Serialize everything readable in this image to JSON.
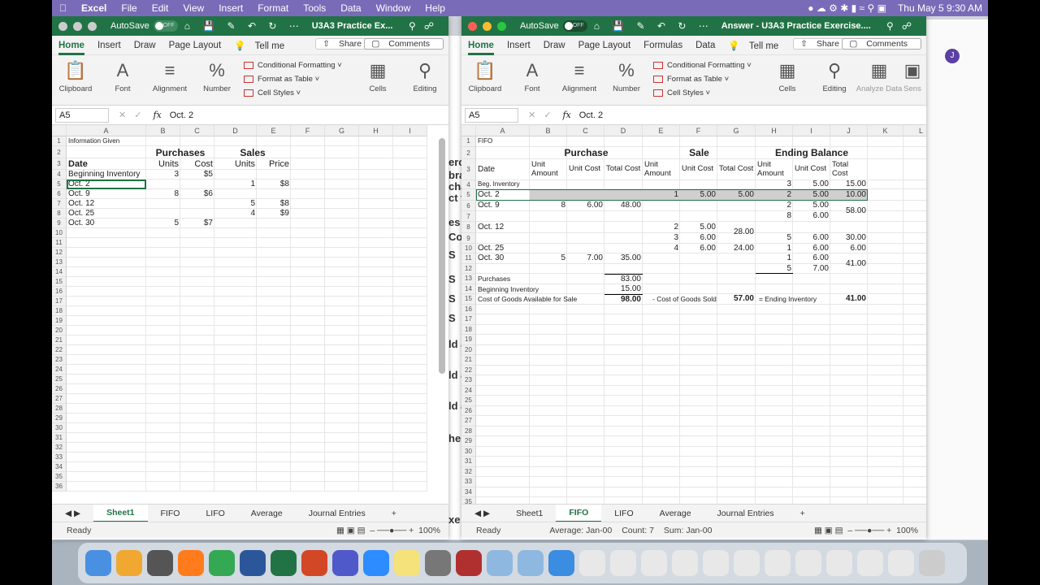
{
  "menubar": {
    "app": "Excel",
    "items": [
      "File",
      "Edit",
      "View",
      "Insert",
      "Format",
      "Tools",
      "Data",
      "Window",
      "Help"
    ],
    "clock": "Thu May 5  9:30 AM"
  },
  "left_window": {
    "autosave_label": "AutoSave",
    "autosave_state": "OFF",
    "title": "U3A3 Practice Ex...",
    "tabs": [
      "Home",
      "Insert",
      "Draw",
      "Page Layout"
    ],
    "tell_me": "Tell me",
    "share": "Share",
    "comments": "Comments",
    "ribbon": {
      "clipboard": "Clipboard",
      "font": "Font",
      "alignment": "Alignment",
      "number": "Number",
      "cond_format": "Conditional Formatting",
      "format_table": "Format as Table",
      "cell_styles": "Cell Styles",
      "cells": "Cells",
      "editing": "Editing"
    },
    "namebox": "A5",
    "formula": "Oct. 2",
    "columns": [
      "A",
      "B",
      "C",
      "D",
      "E",
      "F",
      "G",
      "H",
      "I"
    ],
    "cells": {
      "r1a": "Information Given",
      "r2purch": "Purchases",
      "r2sales": "Sales",
      "r3a": "Date",
      "r3b": "Units",
      "r3c": "Cost",
      "r3d": "Units",
      "r3e": "Price",
      "r4a": "Beginning Inventory",
      "r4b": "3",
      "r4c": "$5",
      "r5a": "Oct. 2",
      "r5d": "1",
      "r5e": "$8",
      "r6a": "Oct. 9",
      "r6b": "8",
      "r6c": "$6",
      "r7a": "Oct. 12",
      "r7d": "5",
      "r7e": "$8",
      "r8a": "Oct. 25",
      "r8d": "4",
      "r8e": "$9",
      "r9a": "Oct. 30",
      "r9b": "5",
      "r9c": "$7"
    },
    "sheet_tabs": [
      "Sheet1",
      "FIFO",
      "LIFO",
      "Average",
      "Journal Entries"
    ],
    "active_tab": "Sheet1",
    "status": "Ready",
    "zoom": "100%"
  },
  "right_window": {
    "autosave_label": "AutoSave",
    "autosave_state": "OFF",
    "title": "Answer - U3A3 Practice Exercise....",
    "tabs": [
      "Home",
      "Insert",
      "Draw",
      "Page Layout",
      "Formulas",
      "Data"
    ],
    "tell_me": "Tell me",
    "share": "Share",
    "comments": "Comments",
    "ribbon": {
      "clipboard": "Clipboard",
      "font": "Font",
      "alignment": "Alignment",
      "number": "Number",
      "cond_format": "Conditional Formatting",
      "format_table": "Format as Table",
      "cell_styles": "Cell Styles",
      "cells": "Cells",
      "editing": "Editing",
      "analyze": "Analyze Data",
      "sens": "Sens"
    },
    "namebox": "A5",
    "formula": "Oct. 2",
    "columns": [
      "A",
      "B",
      "C",
      "D",
      "E",
      "F",
      "G",
      "H",
      "I",
      "J",
      "K",
      "L"
    ],
    "cells": {
      "r1a": "FIFO",
      "r2purch": "Purchase",
      "r2sale": "Sale",
      "r2end": "Ending Balance",
      "r3a": "Date",
      "r3b": "Unit Amount",
      "r3c": "Unit Cost",
      "r3d": "Total Cost",
      "r3e": "Unit Amount",
      "r3f": "Unit Cost",
      "r3g": "Total Cost",
      "r3h": "Unit Amount",
      "r3i": "Unit Cost",
      "r3j": "Total Cost",
      "r4a": "Beg. Inventory",
      "r4h": "3",
      "r4i": "5.00",
      "r4j": "15.00",
      "r5a": "Oct. 2",
      "r5e": "1",
      "r5f": "5.00",
      "r5g": "5.00",
      "r5h": "2",
      "r5i": "5.00",
      "r5j": "10.00",
      "r6a": "Oct. 9",
      "r6b": "8",
      "r6c": "6.00",
      "r6d": "48.00",
      "r6h": "2",
      "r6i": "5.00",
      "r7h": "8",
      "r7i": "6.00",
      "r67j": "58.00",
      "r8a": "Oct. 12",
      "r8e": "2",
      "r8f": "5.00",
      "r89g": "28.00",
      "r9e": "3",
      "r9f": "6.00",
      "r9h": "5",
      "r9i": "6.00",
      "r9j": "30.00",
      "r10a": "Oct. 25",
      "r10e": "4",
      "r10f": "6.00",
      "r10g": "24.00",
      "r10h": "1",
      "r10i": "6.00",
      "r10j": "6.00",
      "r11a": "Oct. 30",
      "r11b": "5",
      "r11c": "7.00",
      "r11d": "35.00",
      "r11h": "1",
      "r11i": "6.00",
      "r12h": "5",
      "r12i": "7.00",
      "r1112j": "41.00",
      "r13a": "Purchases",
      "r13d": "83.00",
      "r14a": "Beginning Inventory",
      "r14d": "15.00",
      "r15a": "Cost of Goods Available for Sale",
      "r15d": "98.00",
      "r15e": "- Cost of Goods Sold",
      "r15g": "57.00",
      "r15h": "= Ending Inventory",
      "r15j": "41.00"
    },
    "sheet_tabs": [
      "Sheet1",
      "FIFO",
      "LIFO",
      "Average",
      "Journal Entries"
    ],
    "active_tab": "FIFO",
    "status": "Ready",
    "average": "Average: Jan-00",
    "count": "Count: 7",
    "sum": "Sum: Jan-00",
    "zoom": "100%"
  },
  "midstrip_text": [
    "erc",
    "bra",
    "cha",
    "ct t",
    "es",
    "Co",
    "S",
    "S",
    "S",
    "S",
    "ld a",
    "ld a",
    "ld a",
    "he",
    "xe"
  ]
}
